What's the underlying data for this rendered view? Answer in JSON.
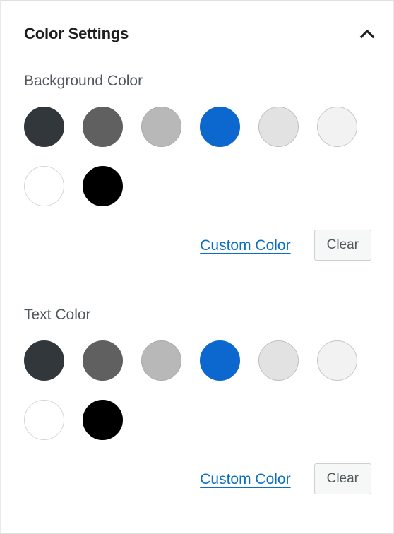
{
  "panel": {
    "title": "Color Settings",
    "collapse_icon": "chevron-up-icon",
    "expanded": true
  },
  "sections": [
    {
      "key": "background_color",
      "label": "Background Color",
      "swatches": [
        {
          "name": "dark-gray",
          "hex": "#32373c"
        },
        {
          "name": "medium-gray",
          "hex": "#606060"
        },
        {
          "name": "light-gray",
          "hex": "#b8b8b8"
        },
        {
          "name": "blue",
          "hex": "#0c68ce"
        },
        {
          "name": "very-light-gray",
          "hex": "#e2e2e2"
        },
        {
          "name": "near-white",
          "hex": "#f2f2f2"
        },
        {
          "name": "white",
          "hex": "#ffffff"
        },
        {
          "name": "black",
          "hex": "#000000"
        }
      ],
      "custom_color_label": "Custom Color",
      "clear_label": "Clear"
    },
    {
      "key": "text_color",
      "label": "Text Color",
      "swatches": [
        {
          "name": "dark-gray",
          "hex": "#32373c"
        },
        {
          "name": "medium-gray",
          "hex": "#606060"
        },
        {
          "name": "light-gray",
          "hex": "#b8b8b8"
        },
        {
          "name": "blue",
          "hex": "#0c68ce"
        },
        {
          "name": "very-light-gray",
          "hex": "#e2e2e2"
        },
        {
          "name": "near-white",
          "hex": "#f2f2f2"
        },
        {
          "name": "white",
          "hex": "#ffffff"
        },
        {
          "name": "black",
          "hex": "#000000"
        }
      ],
      "custom_color_label": "Custom Color",
      "clear_label": "Clear"
    }
  ],
  "theme": {
    "accent_link": "#0b6fc4",
    "title_color": "#1e1e1e",
    "label_color": "#50575e",
    "panel_border": "#e0e0e0",
    "button_bg": "#f6f7f7",
    "button_border": "#cdcfd1"
  }
}
